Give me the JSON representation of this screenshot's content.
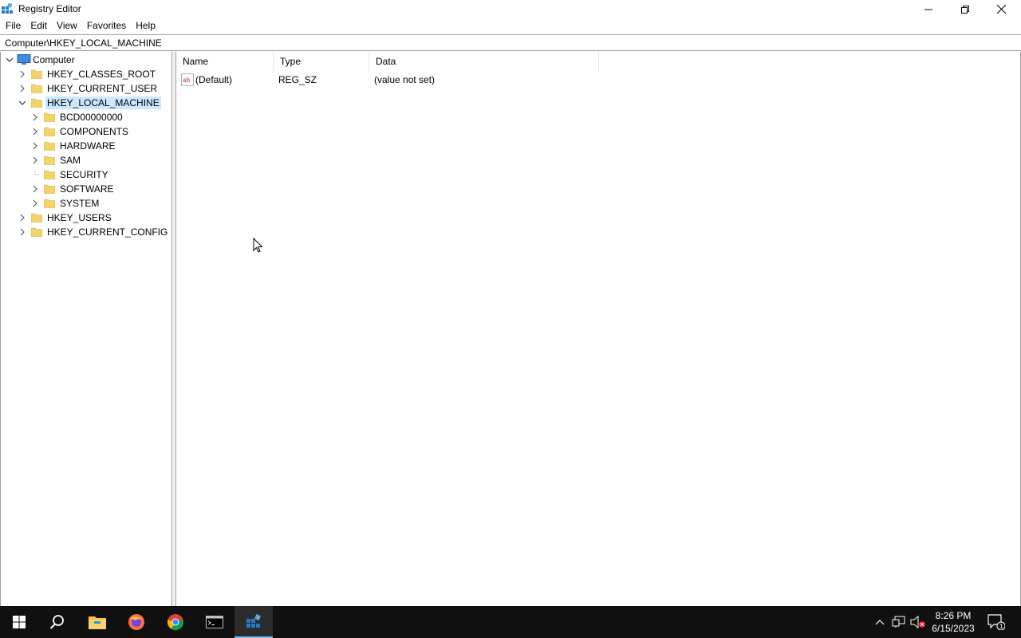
{
  "window": {
    "title": "Registry Editor",
    "minimize_icon": "minimize-icon",
    "maximize_icon": "restore-icon",
    "close_icon": "close-icon"
  },
  "menu": [
    "File",
    "Edit",
    "View",
    "Favorites",
    "Help"
  ],
  "address": {
    "path": "Computer\\HKEY_LOCAL_MACHINE"
  },
  "tree": {
    "root": "Computer",
    "hives": [
      {
        "label": "HKEY_CLASSES_ROOT",
        "expanded": false
      },
      {
        "label": "HKEY_CURRENT_USER",
        "expanded": false
      },
      {
        "label": "HKEY_LOCAL_MACHINE",
        "expanded": true,
        "selected": true
      },
      {
        "label": "HKEY_USERS",
        "expanded": false
      },
      {
        "label": "HKEY_CURRENT_CONFIG",
        "expanded": false
      }
    ],
    "hklm_children": [
      "BCD00000000",
      "COMPONENTS",
      "HARDWARE",
      "SAM",
      "SECURITY",
      "SOFTWARE",
      "SYSTEM"
    ]
  },
  "list": {
    "columns": [
      "Name",
      "Type",
      "Data"
    ],
    "rows": [
      {
        "name": "(Default)",
        "type": "REG_SZ",
        "data": "(value not set)",
        "icon": "string-value-icon"
      }
    ]
  },
  "taskbar": {
    "apps": [
      "start-icon",
      "search-icon",
      "file-explorer-icon",
      "firefox-icon",
      "chrome-icon",
      "terminal-icon",
      "registry-editor-icon"
    ],
    "time": "8:26 PM",
    "date": "6/15/2023",
    "notification_count": "1",
    "colors": {
      "taskbar_bg": "#101010",
      "selection": "#cce8ff",
      "folder": "#f4d36b"
    }
  }
}
